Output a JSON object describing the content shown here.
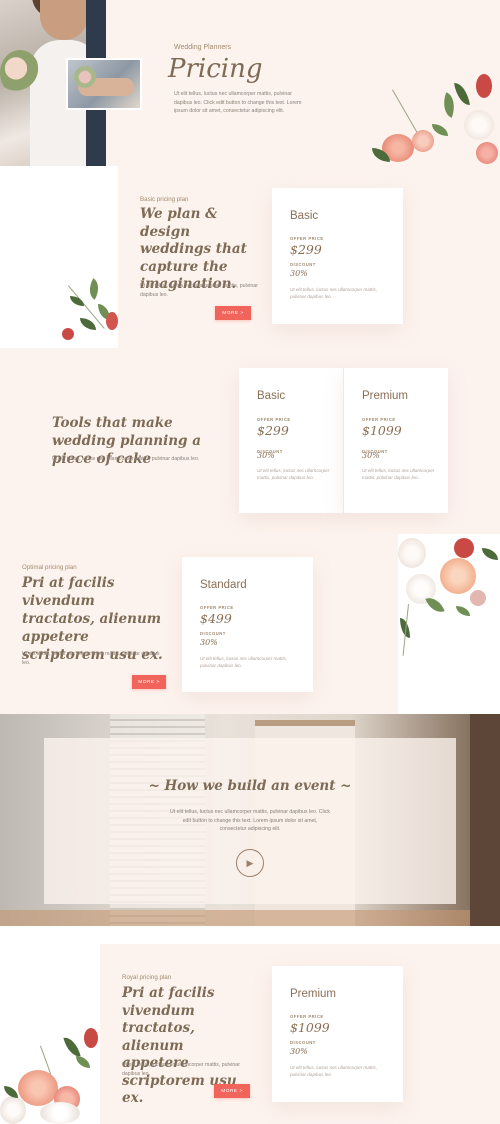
{
  "hero": {
    "kicker": "Wedding Planners",
    "title": "Pricing",
    "text": "Ut elit tellus, luctus nec ullamcorper mattis, pulvinar dapibus leo. Click edit button to change this text. Lorem ipsum dolor sit amet, consectetur adipiscing elit."
  },
  "basic_plan": {
    "kicker": "Basic pricing plan",
    "title": "We plan & design weddings that capture the imagination.",
    "text": "Ut elit tellus, luctus nec ullamcorper mattis, pulvinar dapibus leo.",
    "button": "MORE >",
    "card": {
      "title": "Basic",
      "price_label": "OFFER PRICE",
      "price": "$299",
      "discount_label": "DISCOUNT",
      "discount": "30%",
      "text": "Ut elit tellus, luctus nec ullamcorper mattis, pulvinar dapibus leo."
    }
  },
  "tools": {
    "title": "Tools that make wedding planning a piece of cake",
    "text": "Ut elit tellus, luctus nec ullamcorper mattis, pulvinar dapibus leo.",
    "cards": [
      {
        "title": "Basic",
        "price_label": "OFFER PRICE",
        "price": "$299",
        "discount_label": "DISCOUNT",
        "discount": "30%",
        "text": "Ut elit tellus, luctus nec ullamcorper mattis, pulvinar dapibus leo."
      },
      {
        "title": "Premium",
        "price_label": "OFFER PRICE",
        "price": "$1099",
        "discount_label": "DISCOUNT",
        "discount": "30%",
        "text": "Ut elit tellus, luctus nec ullamcorper mattis, pulvinar dapibus leo."
      }
    ]
  },
  "optimal_plan": {
    "kicker": "Optimal pricing plan",
    "title": "Pri at facilis vivendum tractatos, alienum appetere scriptorem usu ex.",
    "text": "Ut elit tellus, luctus nec ullamcorper mattis, pulvinar dapibus leo.",
    "button": "MORE >",
    "card": {
      "title": "Standard",
      "price_label": "OFFER PRICE",
      "price": "$499",
      "discount_label": "DISCOUNT",
      "discount": "30%",
      "text": "Ut elit tellus, luctus nec ullamcorper mattis, pulvinar dapibus leo."
    }
  },
  "video": {
    "title": "~ How we build an event ~",
    "text": "Ut elit tellus, luctus nec ullamcorper mattis, pulvinar dapibus leo. Click edit button to change this text. Lorem ipsum dolor sit amet, consectetur adipiscing elit."
  },
  "royal_plan": {
    "kicker": "Royal pricing plan",
    "title": "Pri at facilis vivendum tractatos, alienum appetere scriptorem usu ex.",
    "text": "Ut elit tellus, luctus nec ullamcorper mattis, pulvinar dapibus leo.",
    "button": "MORE >",
    "card": {
      "title": "Premium",
      "price_label": "OFFER PRICE",
      "price": "$1099",
      "discount_label": "DISCOUNT",
      "discount": "30%",
      "text": "Ut elit tellus, luctus nec ullamcorper mattis, pulvinar dapibus leo."
    }
  },
  "colors": {
    "background_peach": "#fdf3ee",
    "accent_button": "#f0645c",
    "heading_brown": "#7d6b55"
  }
}
